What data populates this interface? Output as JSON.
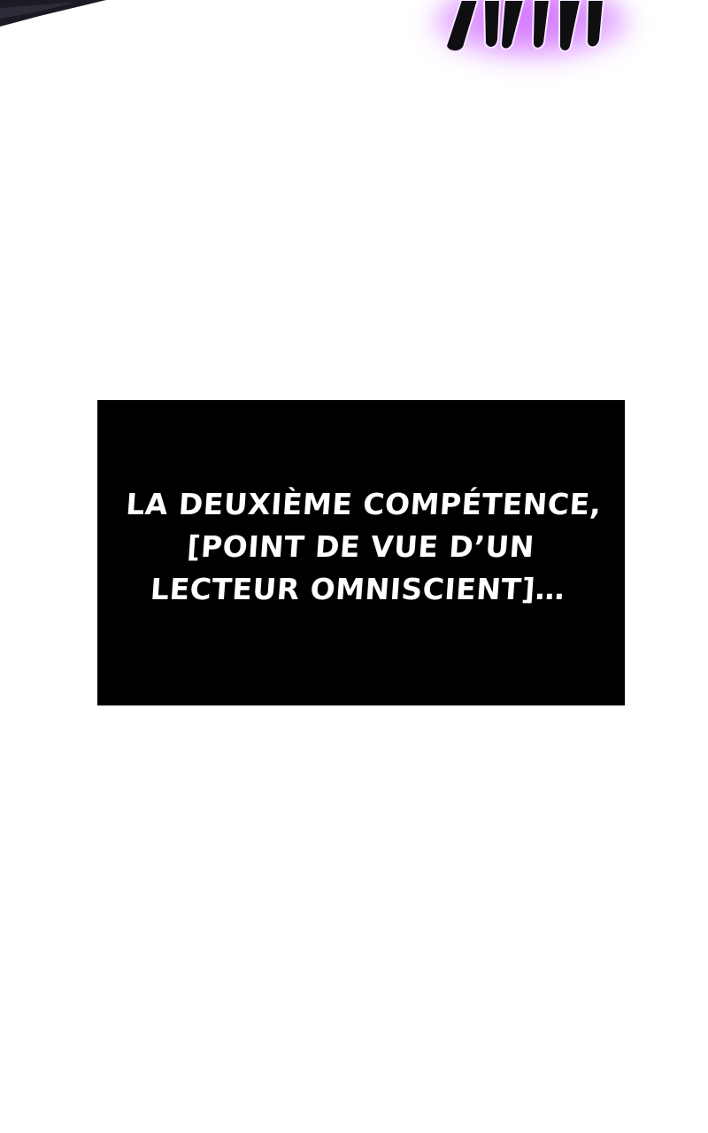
{
  "caption": {
    "lines": [
      "LA DEUXIÈME COMPÉTENCE,",
      "[POINT DE VUE D’UN",
      "LECTEUR OMNISCIENT]…"
    ]
  },
  "colors": {
    "background": "#ffffff",
    "caption_box": "#000000",
    "caption_text": "#ffffff",
    "glow": "#c64bff",
    "dark_shape": "#1b1b24"
  },
  "icons": {
    "top_left": "dark-fragment-icon",
    "top_right": "purple-glow-figure-icon"
  }
}
